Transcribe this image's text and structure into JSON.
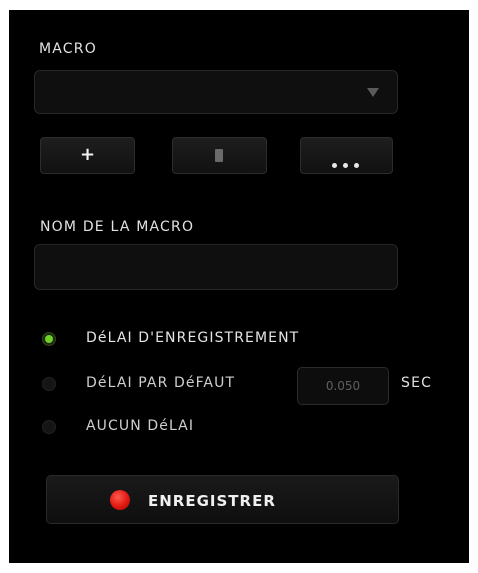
{
  "macro_section": {
    "label": "MACRO",
    "selected_macro": "",
    "dropdown_icon": "chevron-down-icon"
  },
  "macro_buttons": {
    "add_label": "+",
    "delete_icon": "trash-icon",
    "more_icon": "ellipsis-icon"
  },
  "macro_name": {
    "label": "NOM DE LA MACRO",
    "value": ""
  },
  "delay_options": {
    "items": [
      {
        "label": "DéLAI D'ENREGISTREMENT",
        "selected": true
      },
      {
        "label": "DéLAI PAR DéFAUT",
        "selected": false
      },
      {
        "label": "AUCUN DéLAI",
        "selected": false
      }
    ],
    "default_delay_value": "0.050",
    "unit": "SEC"
  },
  "record": {
    "label": "ENREGISTRER",
    "icon": "record-dot-icon"
  },
  "colors": {
    "accent_green": "#6fd12a",
    "record_red": "#e01810",
    "background": "#000000"
  }
}
